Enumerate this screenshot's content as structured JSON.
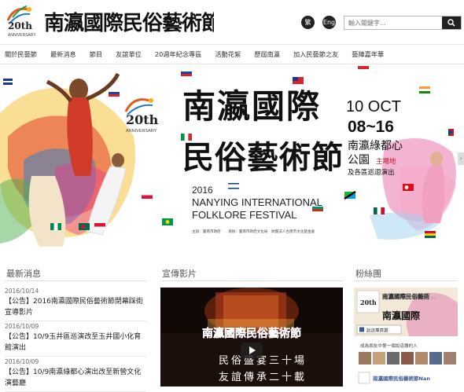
{
  "header": {
    "logo_years": "20th",
    "logo_anniversary": "ANNIVERSARY",
    "logo_title": "南瀛國際民俗藝術節",
    "lang_zh": "繁",
    "lang_en": "Eng",
    "search_placeholder": "輸入關鍵字..."
  },
  "nav": {
    "items": [
      "關於民藝節",
      "最新消息",
      "節目",
      "友誼單位",
      "20週年紀念專區",
      "活動花絮",
      "歷屆南瀛",
      "加入民藝節之友",
      "藝陣嘉年華"
    ]
  },
  "banner": {
    "year": "2016",
    "title_cn_1": "南瀛國際",
    "title_cn_2": "民俗藝術節",
    "title_en_1": "NANYING INTERNATIONAL",
    "title_en_2": "FOLKLORE FESTIVAL",
    "anniv_num": "20th",
    "anniv_text": "ANNIVERSARY",
    "date_line1": "10 OCT",
    "date_line2": "08~16",
    "venue_line1": "南瀛綠都心",
    "venue_line2": "公園",
    "venue_main": "主場地",
    "venue_sub": "及各區巡迴演出",
    "sponsors": "主辦：臺南市政府　　承辦：臺南市政府文化局　財團法人台南市文化基金會",
    "next_arrow": "›"
  },
  "sections": {
    "news_title": "最新消息",
    "video_title": "宣傳影片",
    "fans_title": "粉絲團"
  },
  "news": [
    {
      "date": "2016/10/14",
      "text": "【公告】2016南瀛國際民俗藝術節閉幕踩街宣導影片"
    },
    {
      "date": "2016/10/09",
      "text": "【公告】10/9玉井區巡演改至玉井國小化育館演出"
    },
    {
      "date": "2016/10/09",
      "text": "【公告】10/9南瀛綠都心演出改至新營文化演藝廳"
    }
  ],
  "video": {
    "subtitle": "南瀛國際民俗藝術節",
    "caption_1": "民俗盛宴三十場",
    "caption_2": "友誼傳承二十載"
  },
  "fans": {
    "page_name": "南瀛國際民俗藝術...",
    "like_button": "說這專頁讚",
    "friends_text": "成為朋友中第一個說這讚的人",
    "post_name": "南瀛國際民俗藝術節Nan"
  },
  "colors": {
    "brand_red": "#c0161c",
    "dark": "#222222",
    "nav_text": "#333333"
  }
}
